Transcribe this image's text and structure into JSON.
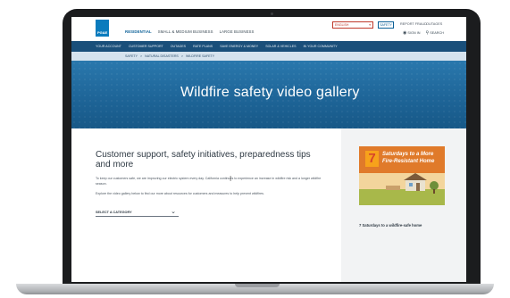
{
  "site": {
    "logo_text": "PG&E",
    "primary_nav": [
      "RESIDENTIAL",
      "SMALL & MEDIUM BUSINESS",
      "LARGE BUSINESS"
    ],
    "language_select": "ENGLISH",
    "utility_button": "SAFETY",
    "utility_links": [
      "REPORT FRAUD",
      "OUTAGES"
    ],
    "sign_in": "SIGN IN",
    "search": "SEARCH",
    "secondary_nav": [
      "YOUR ACCOUNT",
      "CUSTOMER SUPPORT",
      "OUTAGES",
      "RATE PLANS",
      "SAVE ENERGY & MONEY",
      "SOLAR & VEHICLES",
      "IN YOUR COMMUNITY"
    ],
    "breadcrumb": [
      "SAFETY",
      ">",
      "NATURAL DISASTERS",
      ">",
      "WILDFIRE SAFETY"
    ]
  },
  "hero": {
    "title": "Wildfire safety video gallery"
  },
  "main": {
    "heading": "Customer support, safety initiatives, preparedness tips and more",
    "intro": "To keep our customers safe, we are improving our electric system every day. California continues to experience an increase in wildfire risk and a longer wildfire season.",
    "explore": "Explore the video gallery below to find our more about resources for customers and measures to help prevent wildfires.",
    "category_select": "SELECT A CATEGORY"
  },
  "sidebar": {
    "thumb_number": "7",
    "thumb_line1": "Saturdays to a More",
    "thumb_line2": "Fire-Resistant Home",
    "caption": "7 Saturdays to a wildfire-safe home"
  },
  "colors": {
    "brand_blue": "#0a7bbd",
    "nav_dark": "#1a4f7a",
    "hero_blue": "#1e6598",
    "accent_orange": "#f7a21b"
  }
}
